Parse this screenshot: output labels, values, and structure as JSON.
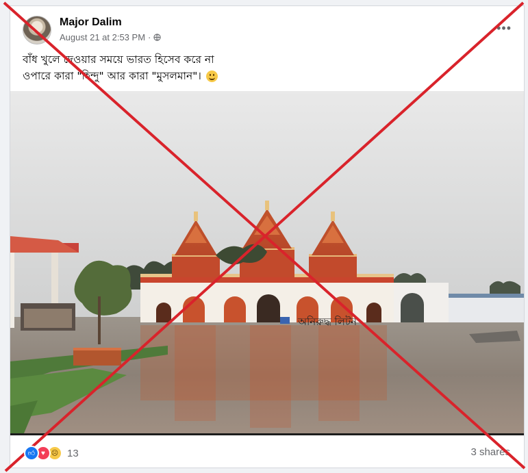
{
  "post": {
    "author": "Major Dalim",
    "timestamp": "August 21 at 2:53 PM",
    "separator": "·",
    "text_line_1": "বাঁধ খুলে দেওয়ার সময়ে ভারত হিসেব করে না",
    "text_line_2": "ওপারে কারা \"হিন্দু\" আর কারা \"মুসলমান\"।",
    "overlay_text": "অনিরুদ্ধ লিটন"
  },
  "footer": {
    "reaction_count": "13",
    "shares": "3 shares"
  },
  "icons": {
    "more": "more-dots-icon",
    "audience": "globe-icon",
    "reactions": [
      "like-icon",
      "love-icon",
      "sad-icon"
    ]
  },
  "colors": {
    "cross": "#d9232b",
    "like": "#1877f2",
    "love": "#f33e58",
    "temple_orange": "#d2562a"
  }
}
